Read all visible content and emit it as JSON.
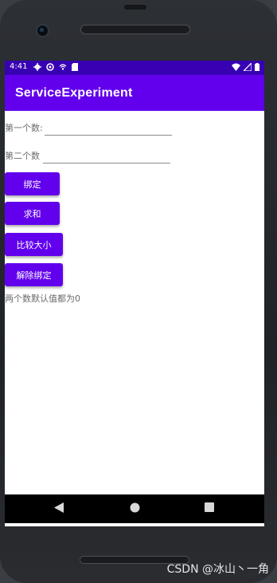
{
  "status_bar": {
    "time": "4:41",
    "icons_left": [
      "gear-icon",
      "sync-icon",
      "wifi-calling-icon",
      "sd-card-icon"
    ],
    "icons_right": [
      "wifi-icon",
      "signal-icon",
      "battery-icon"
    ]
  },
  "app_bar": {
    "title": "ServiceExperiment"
  },
  "form": {
    "first_label": "第一个数:",
    "first_value": "",
    "second_label": "第二个数",
    "second_value": ""
  },
  "buttons": {
    "bind": "绑定",
    "sum": "求和",
    "compare": "比较大小",
    "unbind": "解除绑定"
  },
  "hint": "两个数默认值都为0",
  "watermark": "CSDN @冰山丶一角",
  "colors": {
    "status_bar": "#3700b3",
    "app_bar": "#6200ee",
    "button": "#6200ee"
  }
}
